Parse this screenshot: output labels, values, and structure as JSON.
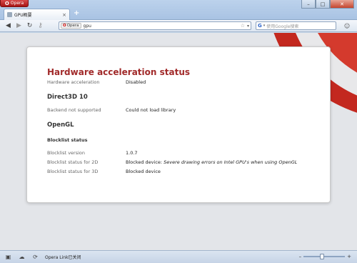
{
  "browser": {
    "menu_label": "Opera",
    "tab": {
      "label": "GPU概要"
    },
    "window_controls": {
      "minimize": "–",
      "maximize": "□",
      "close": "✕"
    },
    "new_tab_symbol": "+"
  },
  "navbar": {
    "address_badge": "Opera",
    "address_text": "gpu",
    "search_engine": "G",
    "search_placeholder": "使用Google搜索"
  },
  "page": {
    "title": "Hardware acceleration status",
    "hw_accel": {
      "label": "Hardware acceleration",
      "value": "Disabled"
    },
    "direct3d": {
      "heading": "Direct3D 10",
      "label": "Backend not supported",
      "value": "Could not load library"
    },
    "opengl": {
      "heading": "OpenGL",
      "blocklist_heading": "Blocklist status",
      "version": {
        "label": "Blocklist version",
        "value": "1.0.7"
      },
      "status2d": {
        "label": "Blocklist status for 2D",
        "value_prefix": "Blocked device: ",
        "value_reason": "Severe drawing errors on Intel GPU's when using OpenGL"
      },
      "status3d": {
        "label": "Blocklist status for 3D",
        "value": "Blocked device"
      }
    }
  },
  "statusbar": {
    "link_text": "Opera Link已关闭",
    "zoom_minus": "–",
    "zoom_plus": "+",
    "zoom_level": 0.45
  },
  "colors": {
    "accent_red": "#a12a2a",
    "chrome_blue": "#bcd2ec"
  },
  "icons": [
    "opera-logo-icon",
    "back-icon",
    "forward-icon",
    "reload-icon",
    "key-icon",
    "star-icon",
    "google-icon",
    "panel-icon",
    "sidebar-toggle-icon",
    "cloud-icon",
    "link-icon"
  ]
}
